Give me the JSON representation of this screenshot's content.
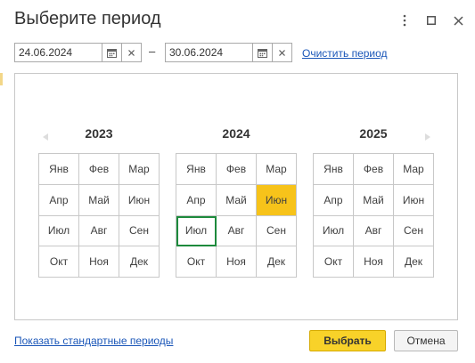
{
  "dialog": {
    "title": "Выберите период"
  },
  "period": {
    "start_date": "24.06.2024",
    "end_date": "30.06.2024",
    "separator": "–",
    "clear_link": "Очистить период"
  },
  "years": [
    {
      "year": "2023",
      "months": [
        "Янв",
        "Фев",
        "Мар",
        "Апр",
        "Май",
        "Июн",
        "Июл",
        "Авг",
        "Сен",
        "Окт",
        "Ноя",
        "Дек"
      ]
    },
    {
      "year": "2024",
      "months": [
        "Янв",
        "Фев",
        "Мар",
        "Апр",
        "Май",
        "Июн",
        "Июл",
        "Авг",
        "Сен",
        "Окт",
        "Ноя",
        "Дек"
      ],
      "selected_month": "Июн",
      "current_month": "Июл"
    },
    {
      "year": "2025",
      "months": [
        "Янв",
        "Фев",
        "Мар",
        "Апр",
        "Май",
        "Июн",
        "Июл",
        "Авг",
        "Сен",
        "Окт",
        "Ноя",
        "Дек"
      ]
    }
  ],
  "footer": {
    "standard_periods_link": "Показать стандартные периоды",
    "select_button": "Выбрать",
    "cancel_button": "Отмена"
  },
  "colors": {
    "selected": "#f7c31a",
    "current_outline": "#1d8a3c",
    "primary_button": "#f8d229",
    "link": "#1a56b8"
  },
  "icons": {
    "more": "more-vertical-icon",
    "maximize": "maximize-icon",
    "close": "close-icon",
    "calendar": "calendar-icon",
    "clear": "clear-x-icon",
    "prev": "arrow-left-icon",
    "next": "arrow-right-icon"
  }
}
